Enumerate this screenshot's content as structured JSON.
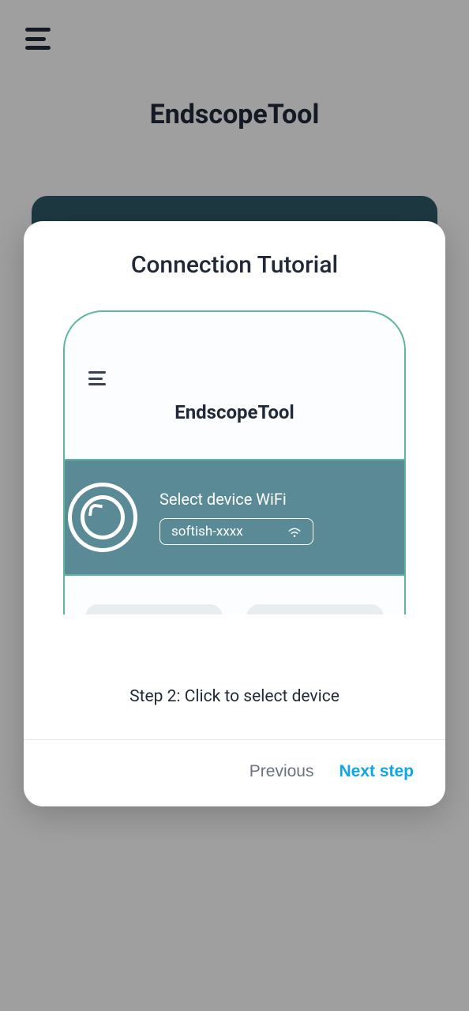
{
  "app": {
    "title": "EndscopeTool"
  },
  "dialog": {
    "title": "Connection Tutorial",
    "step_text": "Step 2: Click to select device",
    "previous_label": "Previous",
    "next_label": "Next step"
  },
  "tutorial": {
    "app_title": "EndscopeTool",
    "wifi_label": "Select device WiFi",
    "wifi_name": "softish-xxxx"
  }
}
